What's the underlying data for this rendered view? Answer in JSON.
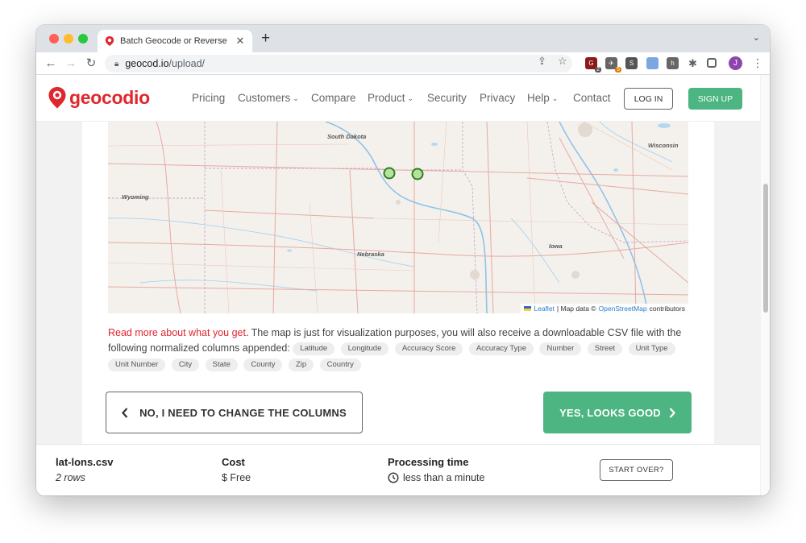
{
  "browser": {
    "tab_title": "Batch Geocode or Reverse Geocode",
    "new_tab_symbol": "+",
    "url_host": "geocod.io",
    "url_path": "/upload/",
    "extension_badges": [
      "2",
      "5"
    ],
    "profile_initial": "J"
  },
  "site": {
    "logo_text": "geocodio",
    "brand_color": "#e0262e",
    "accent_color": "#4cb581",
    "nav": [
      {
        "label": "Pricing",
        "dropdown": false
      },
      {
        "label": "Customers",
        "dropdown": true
      },
      {
        "label": "Compare",
        "dropdown": false
      },
      {
        "label": "Product",
        "dropdown": true
      },
      {
        "label": "Security",
        "dropdown": false
      },
      {
        "label": "Privacy",
        "dropdown": false
      },
      {
        "label": "Help",
        "dropdown": true
      },
      {
        "label": "Contact",
        "dropdown": false
      }
    ],
    "login_label": "LOG IN",
    "signup_label": "SIGN UP"
  },
  "map": {
    "labels": [
      "South Dakota",
      "Wisconsin",
      "Wyoming",
      "Nebraska",
      "Iowa"
    ],
    "markers_count": 2,
    "attribution": {
      "leaflet": "Leaflet",
      "separator": "| Map data ©",
      "osm": "OpenStreetMap",
      "suffix": "contributors"
    }
  },
  "description": {
    "link_text": "Read more about what you get",
    "text": ". The map is just for visualization purposes, you will also receive a downloadable CSV file with the following normalized columns appended:",
    "columns": [
      "Latitude",
      "Longitude",
      "Accuracy Score",
      "Accuracy Type",
      "Number",
      "Street",
      "Unit Type",
      "Unit Number",
      "City",
      "State",
      "County",
      "Zip",
      "Country"
    ]
  },
  "actions": {
    "back_label": "NO, I NEED TO CHANGE THE COLUMNS",
    "confirm_label": "YES, LOOKS GOOD"
  },
  "summary": {
    "file_name": "lat-lons.csv",
    "rows": "2 rows",
    "cost_label": "Cost",
    "cost_value": "$ Free",
    "time_label": "Processing time",
    "time_value": "less than a minute",
    "start_over_label": "START OVER?"
  }
}
